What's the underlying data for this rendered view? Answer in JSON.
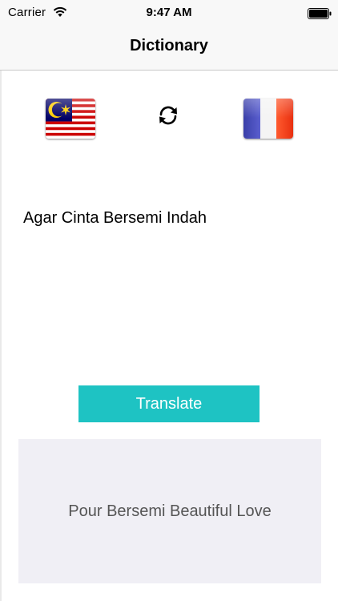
{
  "status_bar": {
    "carrier": "Carrier",
    "time": "9:47 AM"
  },
  "nav": {
    "title": "Dictionary"
  },
  "languages": {
    "source_flag": "malaysia-flag-icon",
    "target_flag": "france-flag-icon",
    "swap_icon": "swap-arrows-icon"
  },
  "input": {
    "value": "Agar Cinta Bersemi Indah"
  },
  "translate_button": {
    "label": "Translate"
  },
  "result": {
    "text": "Pour Bersemi Beautiful Love"
  },
  "colors": {
    "accent": "#1ec3c3",
    "result_background": "#f0eff5",
    "bar_background": "#f8f8f8"
  }
}
